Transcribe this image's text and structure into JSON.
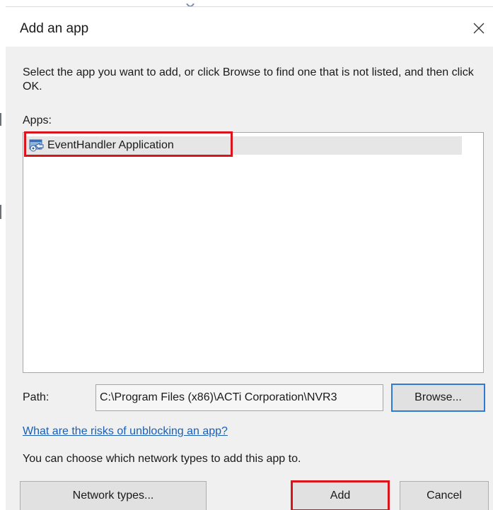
{
  "dialog": {
    "title": "Add an app",
    "close_icon": "close-icon",
    "description": "Select the app you want to add, or click Browse to find one that is not listed, and then click OK.",
    "apps_label": "Apps:",
    "apps": [
      {
        "label": "EventHandler Application",
        "icon": "app-icon",
        "selected": true
      }
    ],
    "path_label": "Path:",
    "path_value": "C:\\Program Files (x86)\\ACTi Corporation\\NVR3",
    "browse_label": "Browse...",
    "risk_link": "What are the risks of unblocking an app?",
    "network_text": "You can choose which network types to add this app to.",
    "network_types_label": "Network types...",
    "add_label": "Add",
    "cancel_label": "Cancel"
  },
  "colors": {
    "highlight": "#d9141c",
    "link": "#1a5fb4",
    "focus_border": "#2f7ad3",
    "dialog_body": "#f0f0f0"
  }
}
